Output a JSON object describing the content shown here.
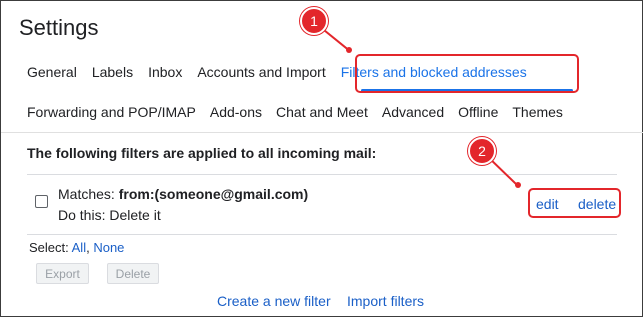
{
  "page": {
    "title": "Settings"
  },
  "tabs_row1": [
    {
      "label": "General"
    },
    {
      "label": "Labels"
    },
    {
      "label": "Inbox"
    },
    {
      "label": "Accounts and Import"
    },
    {
      "label": "Filters and blocked addresses",
      "active": true
    }
  ],
  "tabs_row2": [
    {
      "label": "Forwarding and POP/IMAP"
    },
    {
      "label": "Add-ons"
    },
    {
      "label": "Chat and Meet"
    },
    {
      "label": "Advanced"
    },
    {
      "label": "Offline"
    },
    {
      "label": "Themes"
    }
  ],
  "filters": {
    "heading": "The following filters are applied to all incoming mail:",
    "items": [
      {
        "matches_label": "Matches:",
        "matches_value": "from:(someone@gmail.com)",
        "do_this": "Do this: Delete it",
        "edit_label": "edit",
        "delete_label": "delete"
      }
    ],
    "select_label": "Select:",
    "select_all": "All",
    "select_none": "None",
    "export_label": "Export",
    "delete_label": "Delete",
    "create_filter_link": "Create a new filter",
    "import_filters_link": "Import filters"
  },
  "callouts": [
    {
      "number": "1"
    },
    {
      "number": "2"
    }
  ],
  "colors": {
    "link": "#1a5fc7",
    "active_tab": "#1a73e8",
    "callout": "#e3262b"
  }
}
